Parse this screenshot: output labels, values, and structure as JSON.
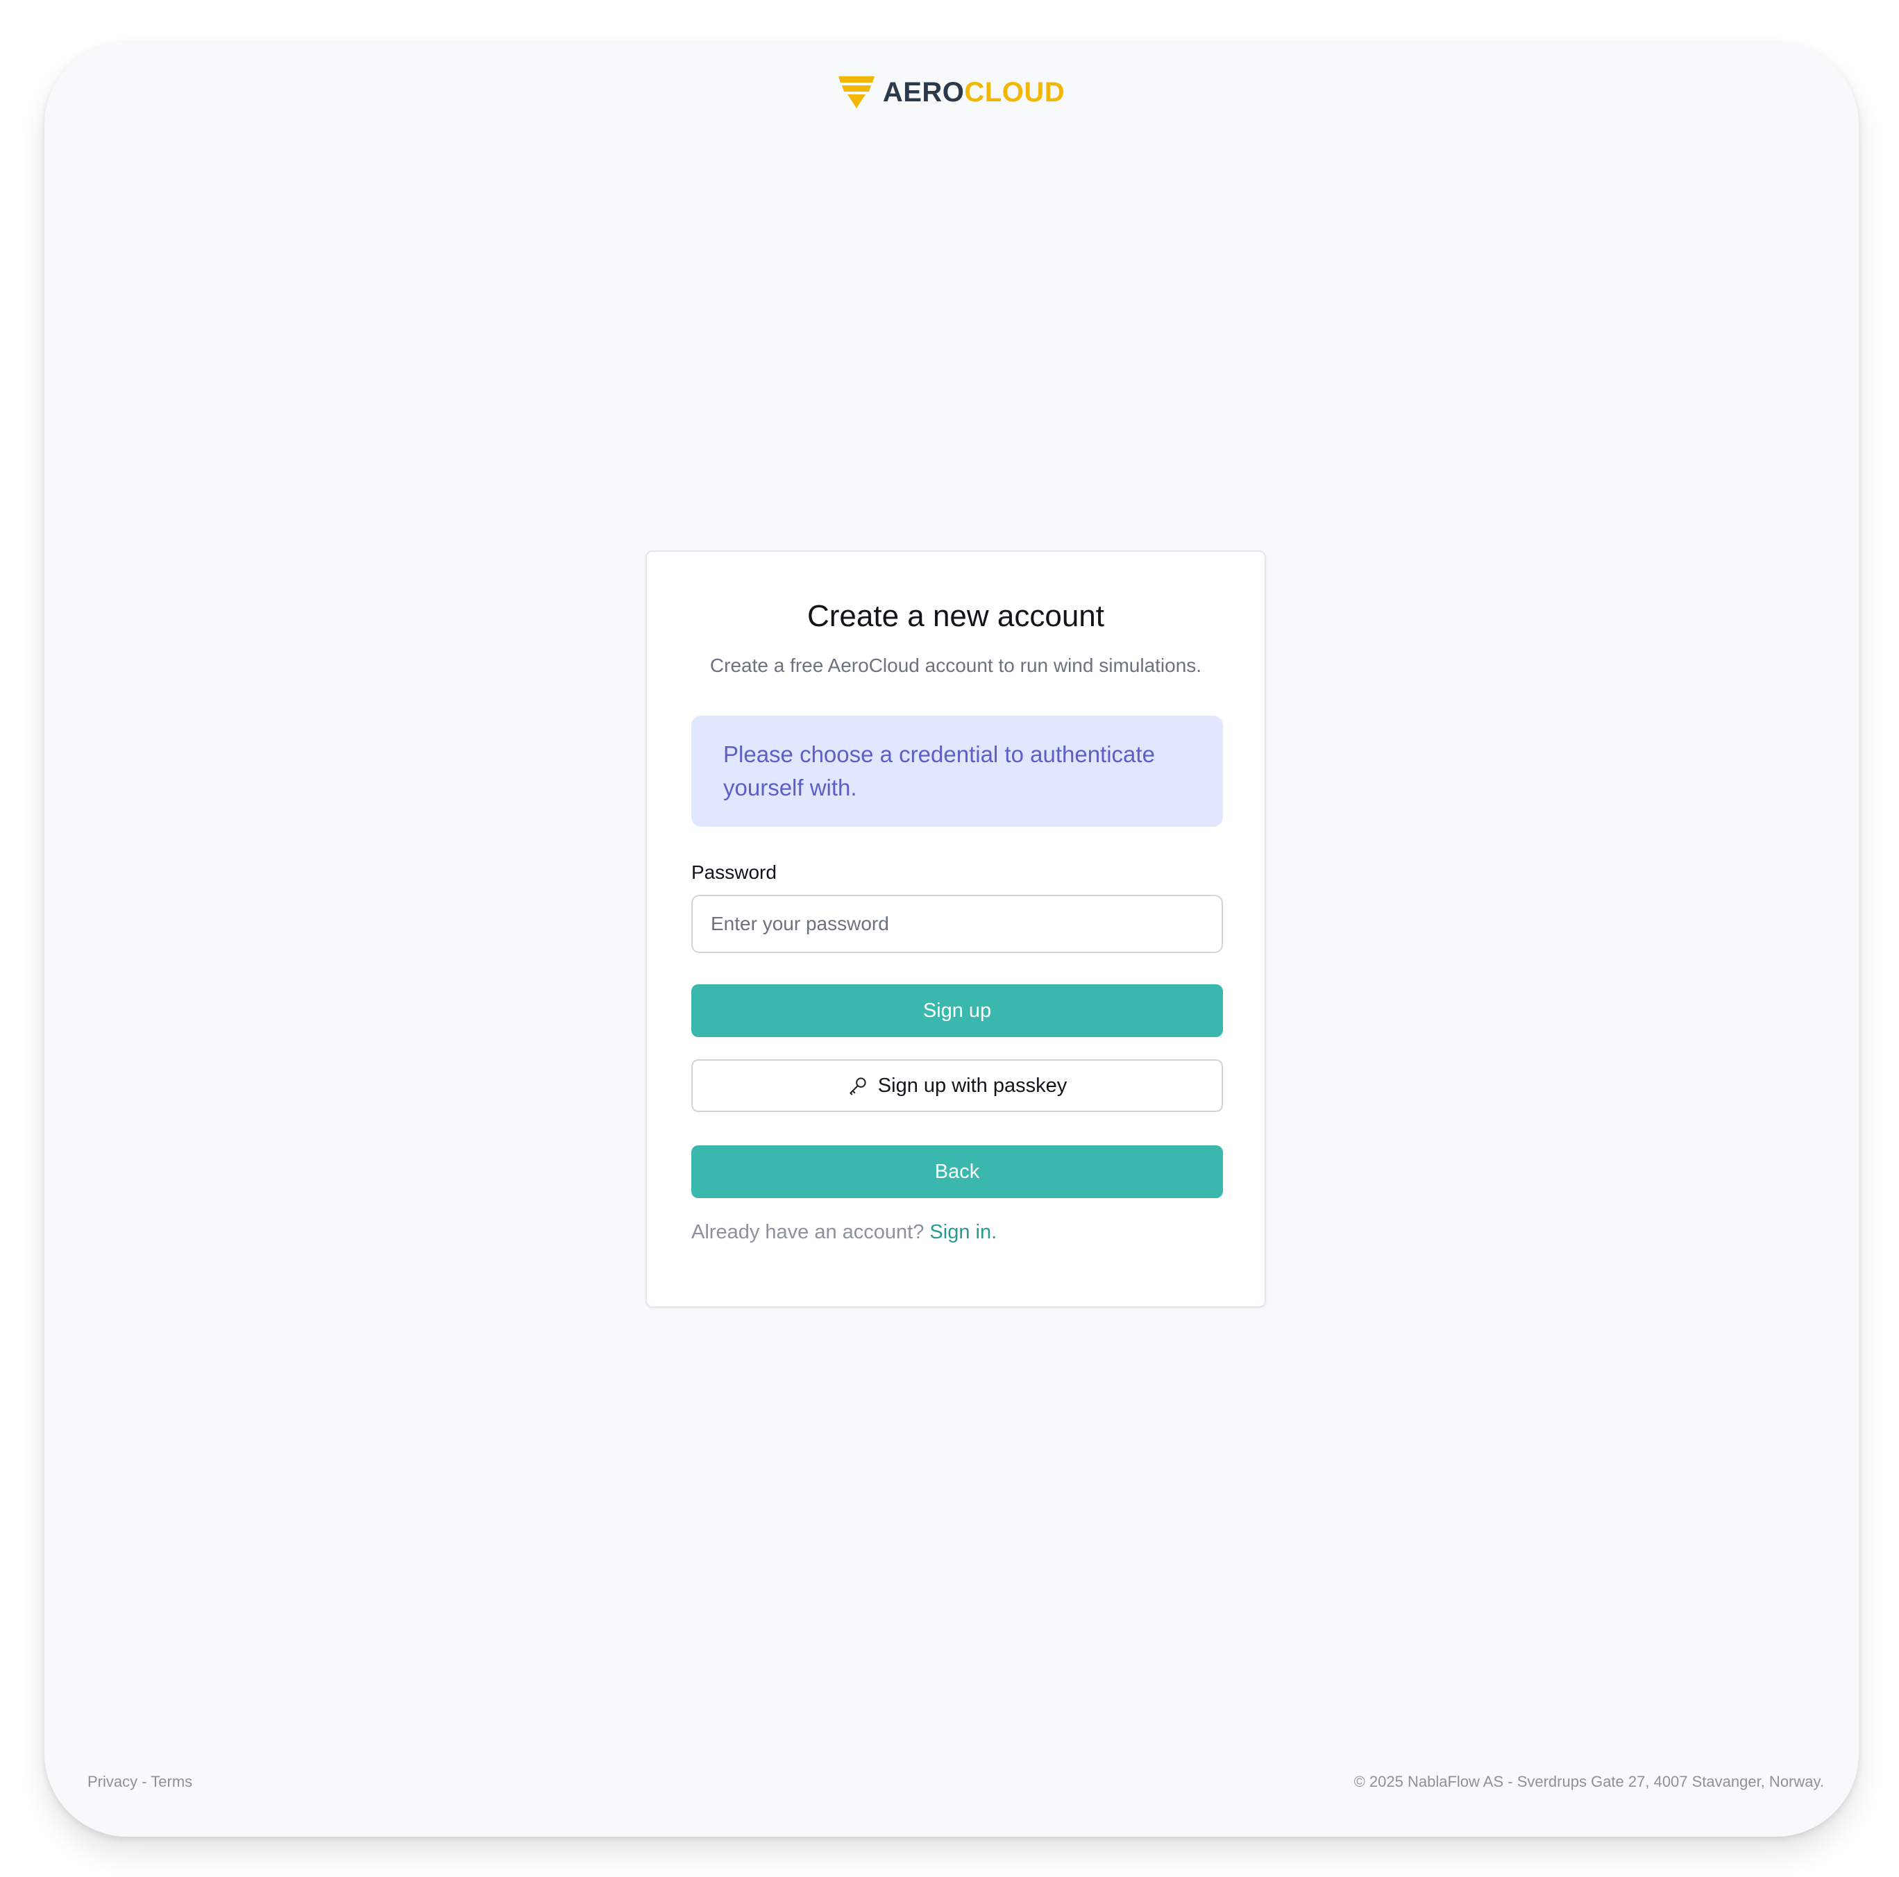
{
  "brand": {
    "name_part1": "AERO",
    "name_part2": "CLOUD",
    "logo_icon": "aerocloud-logo-icon",
    "colors": {
      "dark": "#2b3a4a",
      "accent": "#f2b705"
    }
  },
  "card": {
    "title": "Create a new account",
    "subtitle": "Create a free AeroCloud account to run wind simulations.",
    "alert": "Please choose a credential to authenticate yourself with.",
    "password_label": "Password",
    "password_placeholder": "Enter your password",
    "signup_button": "Sign up",
    "passkey_button": "Sign up with passkey",
    "passkey_icon": "key-icon",
    "back_button": "Back",
    "signin_prompt": "Already have an account?",
    "signin_link": "Sign in."
  },
  "footer": {
    "privacy": "Privacy",
    "separator": " - ",
    "terms": "Terms",
    "copyright": "© 2025 NablaFlow AS - Sverdrups Gate 27, 4007 Stavanger, Norway."
  },
  "colors": {
    "primary": "#3ab8ae",
    "link": "#2a9a91",
    "alert_bg": "#e0e7ff",
    "alert_text": "#5b5fc7"
  }
}
